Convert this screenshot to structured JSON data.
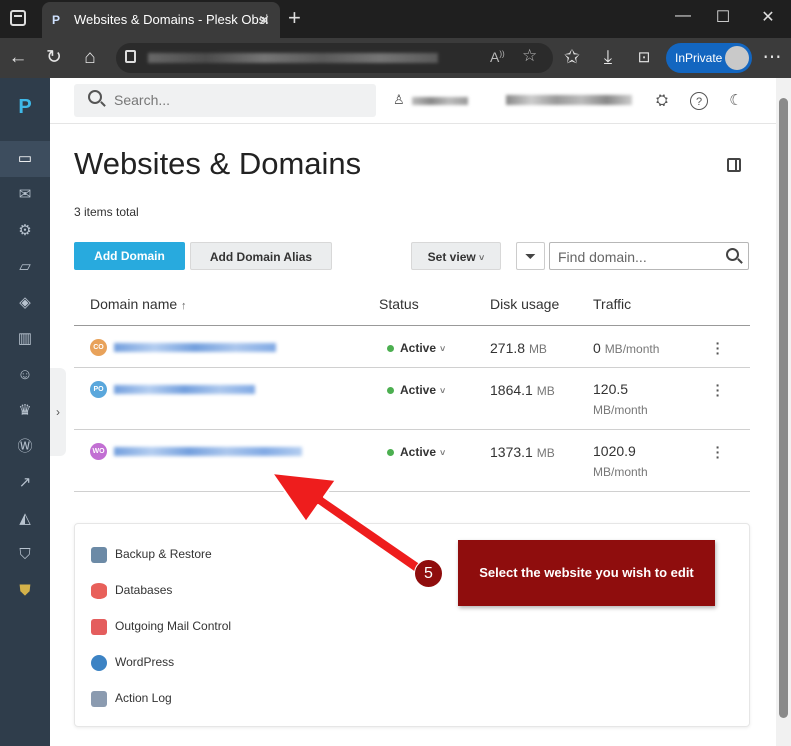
{
  "browser": {
    "tab_title": "Websites & Domains - Plesk Obsi",
    "new_tab": "+",
    "read_aloud": "A̅",
    "inprivate": "InPrivate",
    "tab_favicon": "P"
  },
  "sidebar": {
    "logo": "P",
    "icons": [
      "monitor-icon",
      "mail-icon",
      "gear-icon",
      "folder-icon",
      "layers-icon",
      "chart-icon",
      "user-icon",
      "crown-icon",
      "wordpress-icon",
      "trend-icon",
      "laravel-icon",
      "shield-icon",
      "shield-alt-icon"
    ]
  },
  "topbar": {
    "search_placeholder": "Search..."
  },
  "page": {
    "title": "Websites & Domains",
    "total": "3 items total"
  },
  "toolbar": {
    "add_domain": "Add Domain",
    "add_alias": "Add Domain Alias",
    "set_view": "Set view",
    "find_placeholder": "Find domain..."
  },
  "table": {
    "headers": {
      "domain": "Domain name",
      "sort": "↑",
      "status": "Status",
      "disk": "Disk usage",
      "traffic": "Traffic"
    },
    "rows": [
      {
        "badge": "CO",
        "badge_color": "#e8a25a",
        "status": "Active",
        "disk": "271.8",
        "disk_unit": "MB",
        "traffic": "0",
        "traffic_unit": "MB/month"
      },
      {
        "badge": "PO",
        "badge_color": "#5aa7dc",
        "status": "Active",
        "disk": "1864.1",
        "disk_unit": "MB",
        "traffic": "120.5",
        "traffic_unit": "MB/month"
      },
      {
        "badge": "WO",
        "badge_color": "#c26fd3",
        "status": "Active",
        "disk": "1373.1",
        "disk_unit": "MB",
        "traffic": "1020.9",
        "traffic_unit": "MB/month"
      }
    ]
  },
  "tools": [
    {
      "label": "Backup & Restore",
      "color": "#6c8aa6"
    },
    {
      "label": "Databases",
      "color": "#e8605a"
    },
    {
      "label": "Outgoing Mail Control",
      "color": "#e45d5d"
    },
    {
      "label": "WordPress",
      "color": "#3c83c4"
    },
    {
      "label": "Action Log",
      "color": "#8b9bb0"
    }
  ],
  "callout": {
    "step": "5",
    "text": "Select the website you wish to edit",
    "color": "#8f0d0d"
  }
}
